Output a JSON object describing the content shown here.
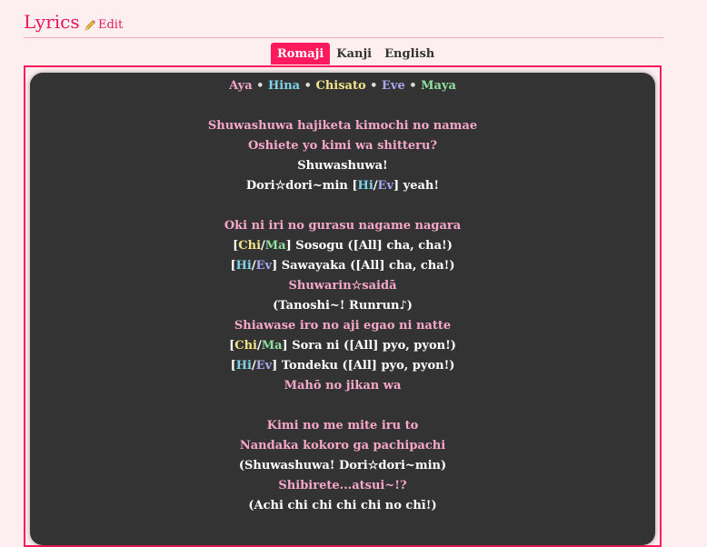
{
  "header": {
    "title": "Lyrics",
    "edit_label": "Edit",
    "edit_icon": "pencil-icon"
  },
  "tabs": [
    {
      "label": "Romaji",
      "active": true
    },
    {
      "label": "Kanji",
      "active": false
    },
    {
      "label": "English",
      "active": false
    }
  ],
  "members": {
    "aya": "Aya",
    "hina": "Hina",
    "chisato": "Chisato",
    "eve": "Eve",
    "maya": "Maya",
    "sep": "•"
  },
  "colors": {
    "accent": "#ff1a5e",
    "aya": "#f4a6c6",
    "hina": "#7fd3e8",
    "chisato": "#f2e48a",
    "eve": "#a8a8f0",
    "maya": "#8fe0a0",
    "panel": "#333333"
  },
  "lyrics": [
    {
      "cls": "pink",
      "text": "Shuwashuwa hajiketa kimochi no namae"
    },
    {
      "cls": "pink",
      "text": "Oshiete yo kimi wa shitteru?"
    },
    {
      "cls": "white",
      "text": "Shuwashuwa!"
    },
    {
      "segments": [
        {
          "cls": "white",
          "text": "Dori☆dori~min ["
        },
        {
          "cls": "c-hina",
          "text": "Hi"
        },
        {
          "cls": "white",
          "text": "/"
        },
        {
          "cls": "c-eve",
          "text": "Ev"
        },
        {
          "cls": "white",
          "text": "] yeah!"
        }
      ]
    },
    {
      "blank": true
    },
    {
      "cls": "pink",
      "text": "Oki ni iri no gurasu nagame nagara"
    },
    {
      "segments": [
        {
          "cls": "white",
          "text": "["
        },
        {
          "cls": "c-chisato",
          "text": "Chi"
        },
        {
          "cls": "white",
          "text": "/"
        },
        {
          "cls": "c-maya",
          "text": "Ma"
        },
        {
          "cls": "white",
          "text": "] Sosogu ([All] cha, cha!)"
        }
      ]
    },
    {
      "segments": [
        {
          "cls": "white",
          "text": "["
        },
        {
          "cls": "c-hina",
          "text": "Hi"
        },
        {
          "cls": "white",
          "text": "/"
        },
        {
          "cls": "c-eve",
          "text": "Ev"
        },
        {
          "cls": "white",
          "text": "] Sawayaka ([All] cha, cha!)"
        }
      ]
    },
    {
      "cls": "pink",
      "text": "Shuwarin☆saidā"
    },
    {
      "cls": "white",
      "text": "(Tanoshi~! Runrun♪)"
    },
    {
      "cls": "pink",
      "text": "Shiawase iro no aji egao ni natte"
    },
    {
      "segments": [
        {
          "cls": "white",
          "text": "["
        },
        {
          "cls": "c-chisato",
          "text": "Chi"
        },
        {
          "cls": "white",
          "text": "/"
        },
        {
          "cls": "c-maya",
          "text": "Ma"
        },
        {
          "cls": "white",
          "text": "] Sora ni ([All] pyo, pyon!)"
        }
      ]
    },
    {
      "segments": [
        {
          "cls": "white",
          "text": "["
        },
        {
          "cls": "c-hina",
          "text": "Hi"
        },
        {
          "cls": "white",
          "text": "/"
        },
        {
          "cls": "c-eve",
          "text": "Ev"
        },
        {
          "cls": "white",
          "text": "] Tondeku ([All] pyo, pyon!)"
        }
      ]
    },
    {
      "cls": "pink",
      "text": "Mahō no jikan wa"
    },
    {
      "blank": true
    },
    {
      "cls": "pink",
      "text": "Kimi no me mite iru to"
    },
    {
      "cls": "pink",
      "text": "Nandaka kokoro ga pachipachi"
    },
    {
      "cls": "white",
      "text": "(Shuwashuwa! Dori☆dori~min)"
    },
    {
      "cls": "pink",
      "text": "Shibirete...atsui~!?"
    },
    {
      "cls": "white",
      "text": "(Achi chi chi chi chi no chī!)"
    }
  ]
}
